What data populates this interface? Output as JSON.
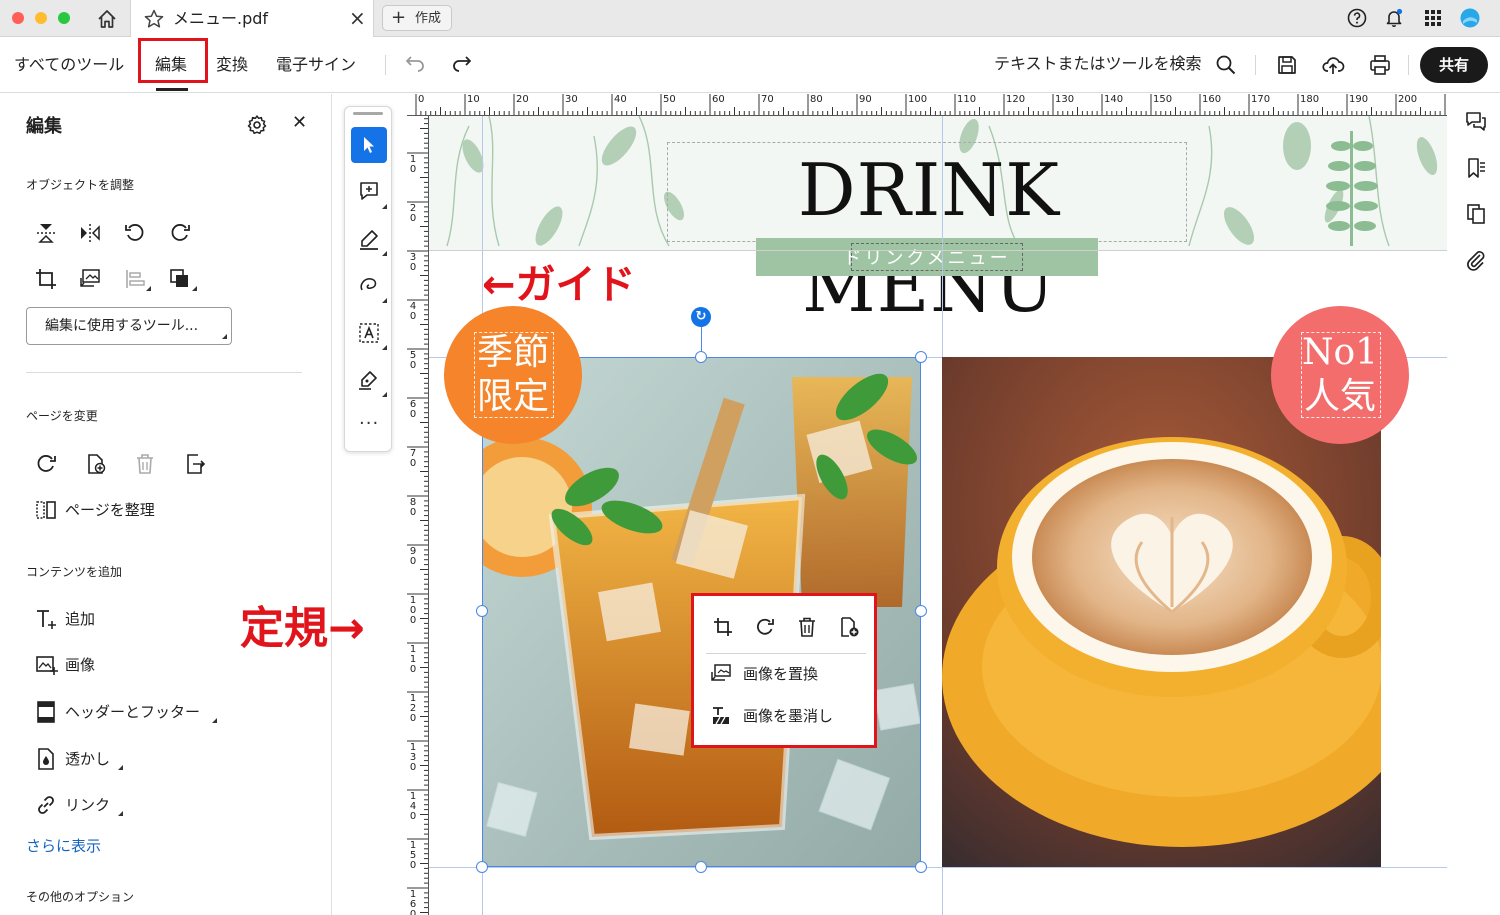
{
  "tabbar": {
    "doc_tab_title": "メニュー.pdf",
    "create_tab_label": "作成"
  },
  "menubar": {
    "items": [
      "すべてのツール",
      "編集",
      "変換",
      "電子サイン"
    ],
    "search_label": "テキストまたはツールを検索",
    "share_label": "共有"
  },
  "panel": {
    "title": "編集",
    "section_adjust": "オブジェクトを調整",
    "dropdown_label": "編集に使用するツール...",
    "section_page": "ページを変更",
    "organize_label": "ページを整理",
    "section_content": "コンテンツを追加",
    "content_items": [
      "追加",
      "画像",
      "ヘッダーとフッター",
      "透かし",
      "リンク"
    ],
    "show_more": "さらに表示",
    "section_other": "その他のオプション"
  },
  "ruler": {
    "top_ticks": [
      "0",
      "10",
      "20",
      "30",
      "40",
      "50",
      "60",
      "70",
      "80",
      "90",
      "100",
      "110",
      "120",
      "130",
      "140",
      "150",
      "160",
      "170",
      "180",
      "190",
      "200"
    ],
    "left_ticks": [
      "10",
      "20",
      "30",
      "40",
      "50",
      "60",
      "70",
      "80",
      "90",
      "100",
      "110",
      "120",
      "130",
      "140",
      "150",
      "160"
    ]
  },
  "document": {
    "title": "DRINK MENU",
    "subtitle": "ドリンクメニュー",
    "badge_left": [
      "季節",
      "限定"
    ],
    "badge_right": [
      "No1",
      "人気"
    ]
  },
  "annotations": {
    "guide": "←ガイド",
    "ruler": "定規→"
  },
  "context_menu": {
    "replace_label": "画像を置換",
    "redact_label": "画像を墨消し"
  },
  "colors": {
    "accent_blue": "#1473e6",
    "highlight_red": "#e1141b",
    "badge_orange": "#f5842b",
    "badge_pink": "#f46d6d",
    "subtitle_green": "#9ec4a4",
    "link_blue": "#1565c0"
  }
}
